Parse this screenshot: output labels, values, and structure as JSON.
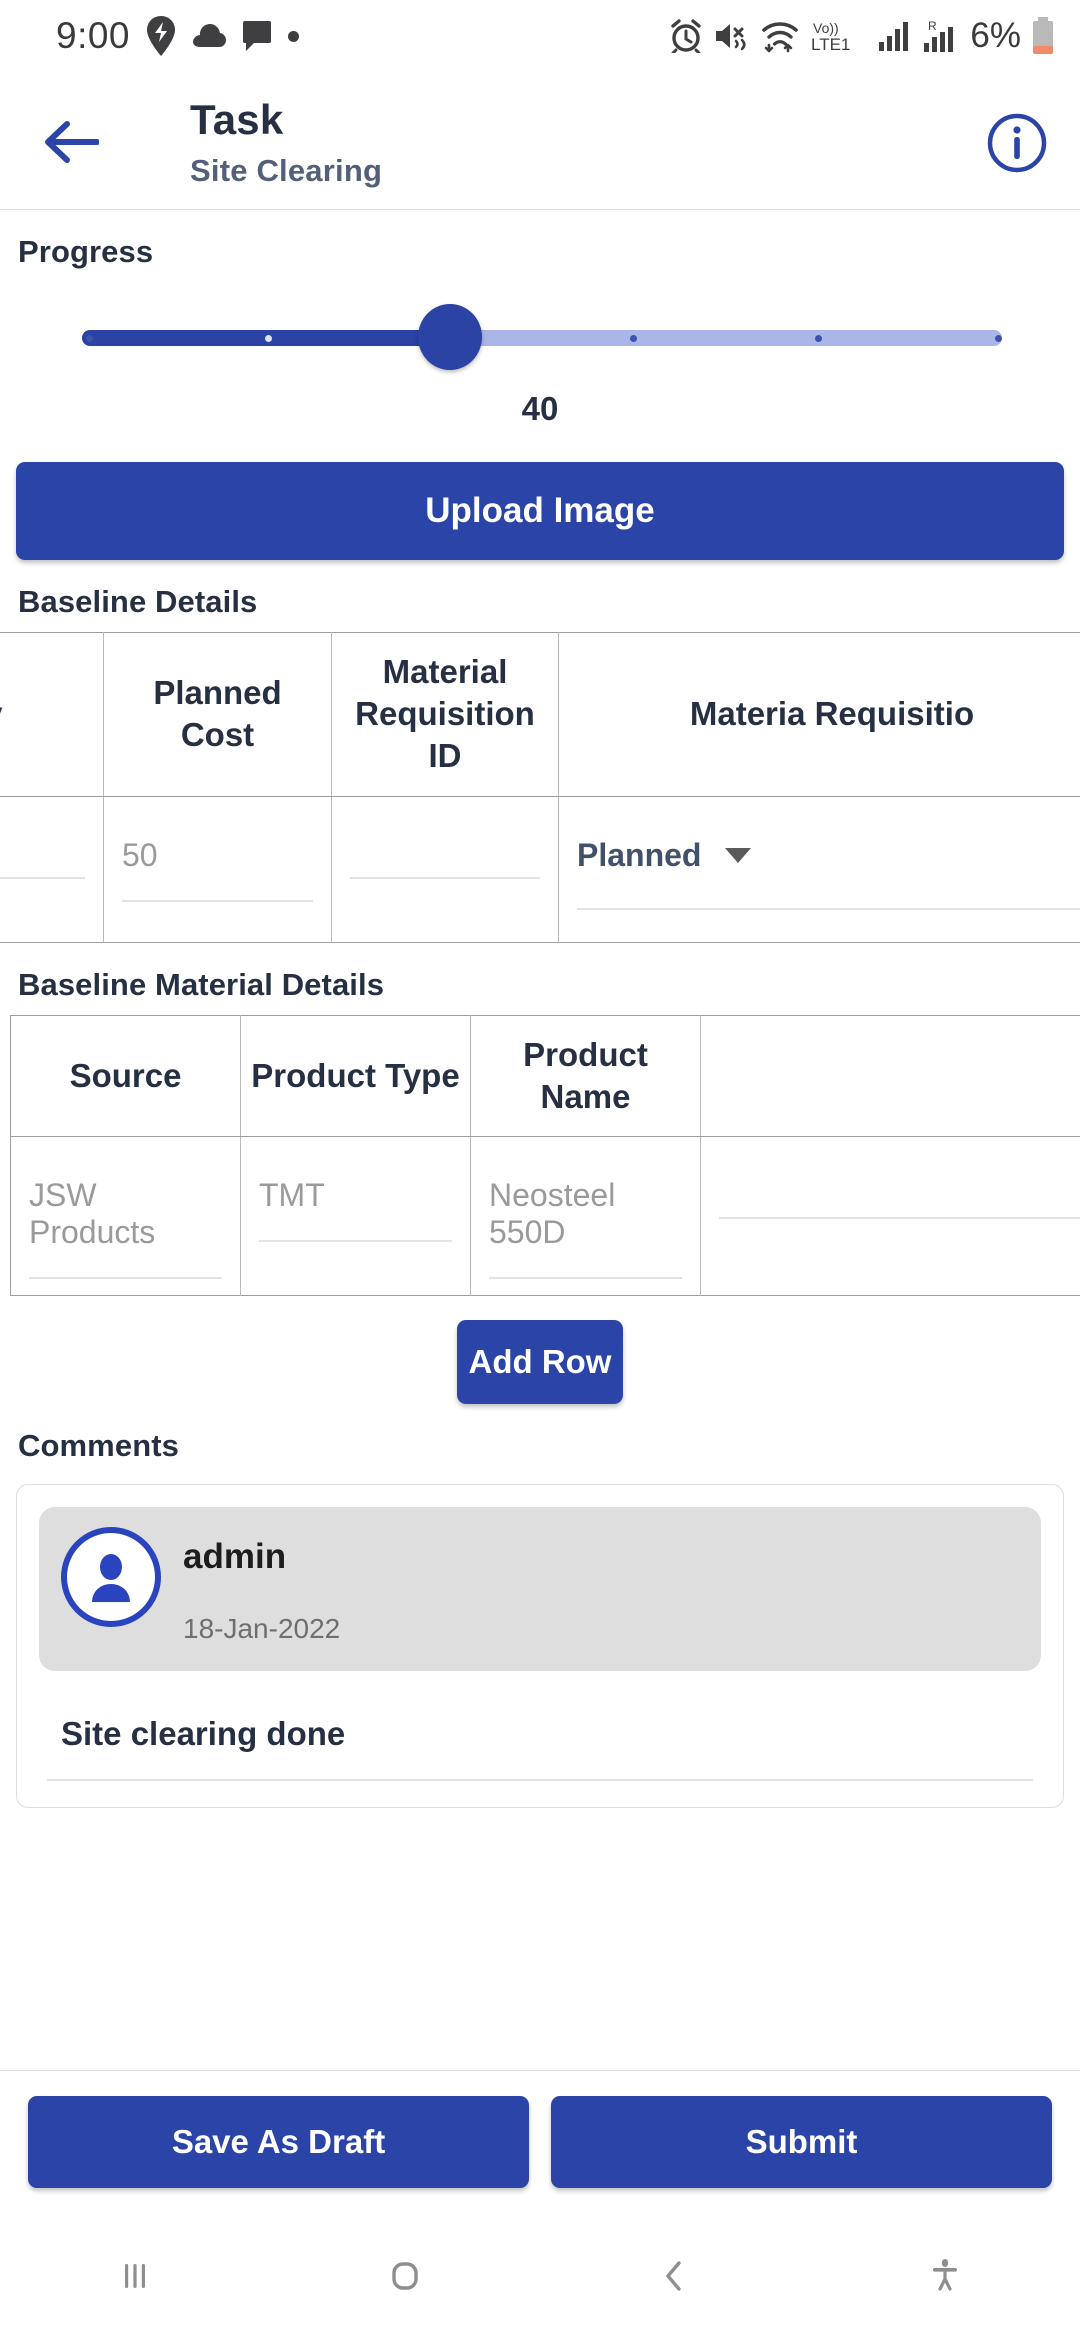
{
  "status_bar": {
    "time": "9:00",
    "left_icons": [
      "location-pin-icon",
      "cloud-icon",
      "chat-bubble-icon",
      "dot-icon"
    ],
    "right_icons": [
      "alarm-icon",
      "mute-vibrate-icon",
      "wifi-icon",
      "volte-icon",
      "signal-bars-icon",
      "roaming-signal-icon"
    ],
    "network_label": "VoLTE1",
    "roaming_label": "R",
    "battery_percent": "6%"
  },
  "header": {
    "back_icon": "arrow-left-icon",
    "title": "Task",
    "subtitle": "Site Clearing",
    "info_icon": "info-circle-icon"
  },
  "progress": {
    "label": "Progress",
    "value": "40",
    "min": 0,
    "max": 100,
    "ticks": [
      0,
      25,
      50,
      75,
      100
    ]
  },
  "upload": {
    "button_label": "Upload Image"
  },
  "baseline_details": {
    "label": "Baseline Details",
    "columns": [
      "lay",
      "Planned Cost",
      "Material Requisition ID",
      "Materia Requisitio"
    ],
    "rows": [
      {
        "cells": [
          {
            "value": "",
            "type": "text"
          },
          {
            "value": "50",
            "type": "text"
          },
          {
            "value": "",
            "type": "text"
          },
          {
            "value": "Planned",
            "type": "dropdown"
          }
        ]
      }
    ]
  },
  "baseline_material_details": {
    "label": "Baseline Material Details",
    "columns": [
      "Source",
      "Product Type",
      "Product Name",
      ""
    ],
    "rows": [
      {
        "cells": [
          {
            "value": "JSW Products",
            "type": "text"
          },
          {
            "value": "TMT",
            "type": "text"
          },
          {
            "value": "Neosteel 550D",
            "type": "text"
          },
          {
            "value": "",
            "type": "text"
          }
        ]
      }
    ],
    "add_row_label": "Add Row"
  },
  "comments": {
    "label": "Comments",
    "items": [
      {
        "avatar_icon": "person-avatar-icon",
        "author": "admin",
        "date": "18-Jan-2022",
        "text": "Site clearing done"
      }
    ]
  },
  "actions": {
    "save_draft_label": "Save As Draft",
    "submit_label": "Submit"
  },
  "nav_bar": {
    "items": [
      {
        "icon": "recent-apps-icon"
      },
      {
        "icon": "home-icon"
      },
      {
        "icon": "back-chevron-icon"
      },
      {
        "icon": "accessibility-icon"
      }
    ]
  },
  "colors": {
    "primary": "#2a44a8",
    "title": "#273043",
    "subtitle": "#53607a",
    "placeholder": "#9a9a9a",
    "track": "#aab6e8"
  }
}
